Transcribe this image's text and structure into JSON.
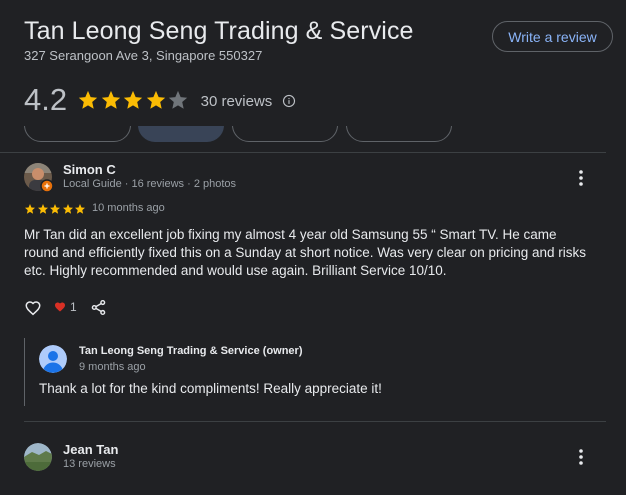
{
  "business": {
    "name": "Tan Leong Seng Trading & Service",
    "address": "327 Serangoon Ave 3, Singapore 550327",
    "write_review_label": "Write a review"
  },
  "rating": {
    "value": "4.2",
    "stars": 4.2,
    "count_label": "30 reviews",
    "star_color": "#fbbc04"
  },
  "reviews": [
    {
      "name": "Simon C",
      "meta": "Local Guide · 16 reviews · 2 photos",
      "stars": 5,
      "date": "10 months ago",
      "text": "Mr Tan did an excellent job fixing my almost 4 year old Samsung 55 “ Smart TV. He came round and efficiently fixed this on a Sunday at short notice. Was very clear on pricing and risks etc. Highly recommended and would use again. Brilliant Service 10/10.",
      "likes": "1",
      "owner_reply": {
        "name": "Tan Leong Seng Trading & Service (owner)",
        "date": "9 months ago",
        "text": "Thank a lot for the kind compliments! Really appreciate it!"
      }
    },
    {
      "name": "Jean Tan",
      "meta": "13 reviews"
    }
  ],
  "icons": {
    "info": "info-icon",
    "more": "more-vert-icon",
    "like": "heart-outline-icon",
    "liked": "heart-filled-icon",
    "share": "share-icon",
    "local_guide": "local-guide-badge-icon"
  },
  "colors": {
    "accent": "#8ab4f8",
    "heart": "#d93025",
    "background": "#202124"
  }
}
